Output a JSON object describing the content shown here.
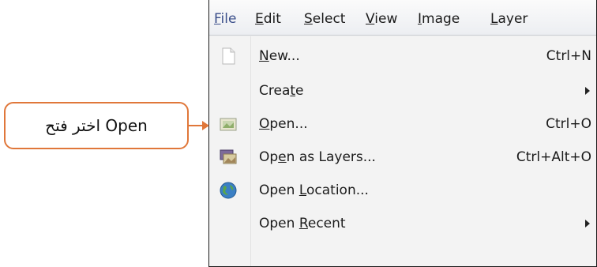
{
  "callout": {
    "text": "اختر فتح Open"
  },
  "colors": {
    "accent": "#e0773a",
    "menu_bg": "#f3f3f3",
    "file_menu": "#3a4e8a"
  },
  "menubar": {
    "items": [
      {
        "pre": "",
        "u": "F",
        "post": "ile"
      },
      {
        "pre": "",
        "u": "E",
        "post": "dit"
      },
      {
        "pre": "",
        "u": "S",
        "post": "elect"
      },
      {
        "pre": "",
        "u": "V",
        "post": "iew"
      },
      {
        "pre": "",
        "u": "I",
        "post": "mage"
      },
      {
        "pre": "",
        "u": "L",
        "post": "ayer"
      }
    ]
  },
  "menu": {
    "items": [
      {
        "pre": "",
        "u": "N",
        "post": "ew...",
        "shortcut": "Ctrl+N",
        "icon": "new-file-icon"
      },
      {
        "pre": "Crea",
        "u": "t",
        "post": "e",
        "shortcut": "",
        "icon": ""
      },
      {
        "pre": "",
        "u": "O",
        "post": "pen...",
        "shortcut": "Ctrl+O",
        "icon": "open-image-icon"
      },
      {
        "pre": "Op",
        "u": "e",
        "post": "n as Layers...",
        "shortcut": "Ctrl+Alt+O",
        "icon": "open-layers-icon"
      },
      {
        "pre": "Open ",
        "u": "L",
        "post": "ocation...",
        "shortcut": "",
        "icon": "globe-icon"
      },
      {
        "pre": "Open ",
        "u": "R",
        "post": "ecent",
        "shortcut": "",
        "icon": ""
      }
    ]
  }
}
